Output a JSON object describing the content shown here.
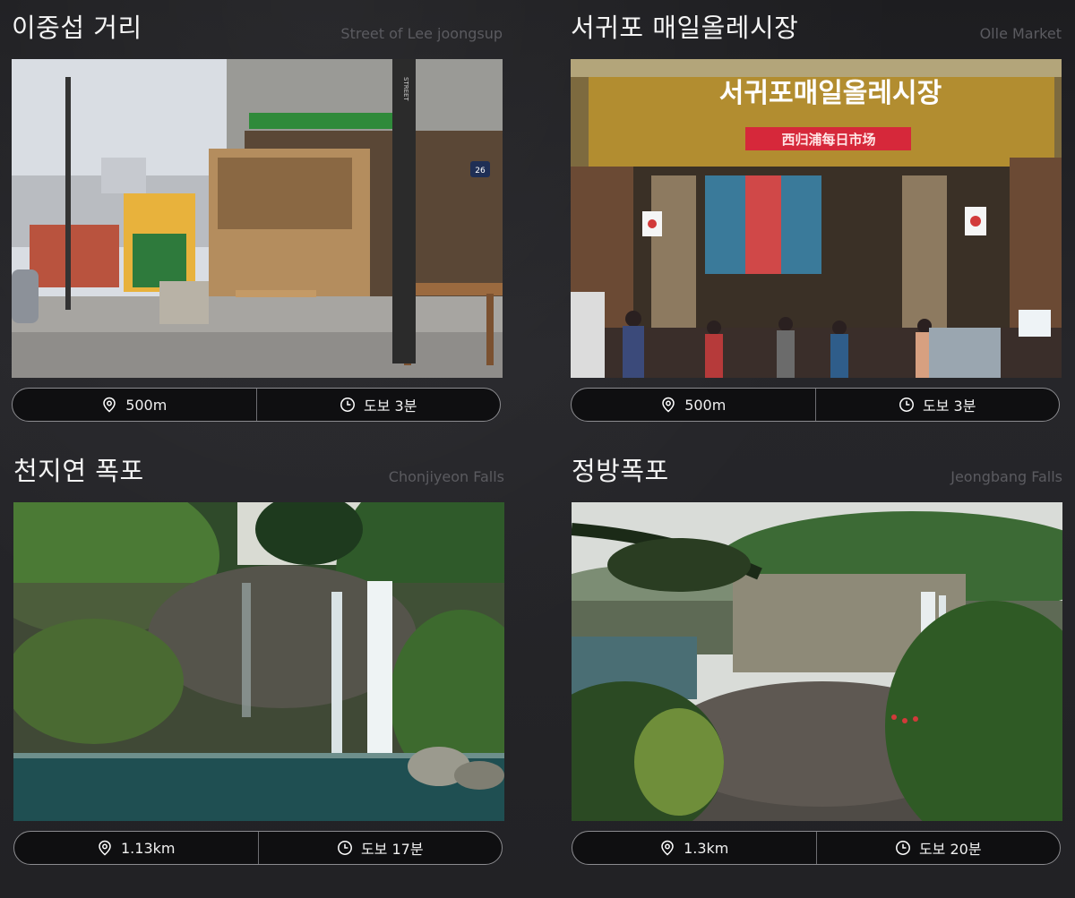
{
  "cards": [
    {
      "title": "이중섭 거리",
      "subtitle": "Street of Lee joongsup",
      "distance": "500m",
      "walk": "도보 3분",
      "sign_top": "STREET",
      "sign_number": "26"
    },
    {
      "title": "서귀포 매일올레시장",
      "subtitle": "Olle Market",
      "distance": "500m",
      "walk": "도보 3분",
      "sign_main": "서귀포매일올레시장",
      "sign_sub": "西归浦每日市场"
    },
    {
      "title": "천지연 폭포",
      "subtitle": "Chonjiyeon Falls",
      "distance": "1.13km",
      "walk": "도보 17분"
    },
    {
      "title": "정방폭포",
      "subtitle": "Jeongbang Falls",
      "distance": "1.3km",
      "walk": "도보 20분"
    }
  ],
  "icons": {
    "distance": "location-pin-icon",
    "walk": "clock-icon"
  },
  "colors": {
    "bar_border": "#8b8b8f",
    "bar_bg": "#0f0f11",
    "subtitle": "#5b5b60"
  }
}
